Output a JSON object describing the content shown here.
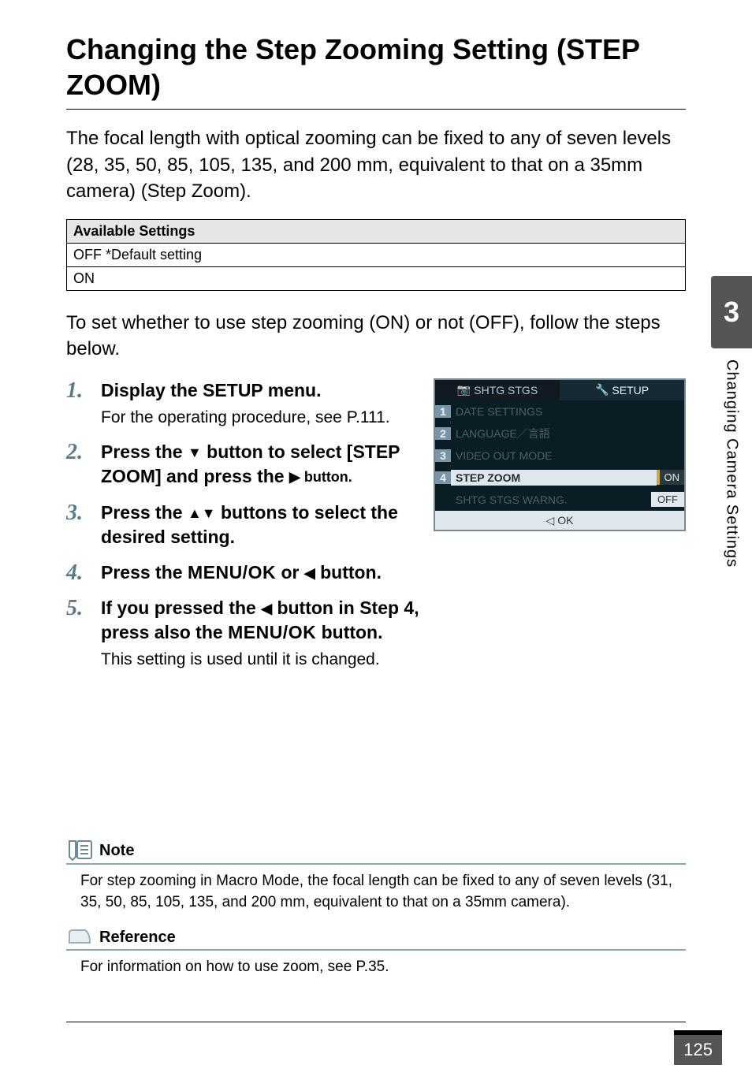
{
  "chapter_tab": {
    "number": "3",
    "label": "Changing Camera Settings"
  },
  "title": "Changing the Step Zooming Setting (STEP ZOOM)",
  "intro": "The focal length with optical zooming can be fixed to any of seven levels (28, 35, 50, 85, 105, 135, and 200 mm, equivalent to that on a 35mm camera) (Step Zoom).",
  "table": {
    "header": "Available Settings",
    "rows": [
      "OFF *Default setting",
      "ON"
    ]
  },
  "para2": "To set whether to use step zooming (ON) or not (OFF), follow the steps below.",
  "steps": [
    {
      "head": "Display the SETUP menu.",
      "sub": "For the operating procedure, see P.111."
    },
    {
      "head_pre": "Press the ",
      "head_mid": "▼",
      "head_post": " button to select [STEP ZOOM] and press the ",
      "head_tail": "▶ button."
    },
    {
      "head_pre": "Press the ",
      "head_mid": "▲▼",
      "head_post": " buttons to select the desired setting."
    },
    {
      "head_pre": "Press the ",
      "head_key": "MENU/OK",
      "head_mid": " or ",
      "head_tri": "◀",
      "head_post": " button."
    },
    {
      "head_pre": "If you pressed the ",
      "head_tri": "◀",
      "head_mid": " button in Step 4, press also the ",
      "head_key": "MENU/OK",
      "head_post": " button.",
      "sub": "This setting is used until it is changed."
    }
  ],
  "lcd": {
    "tab1_icon": "camera-icon",
    "tab1_label": "SHTG STGS",
    "tab2_icon": "wrench-icon",
    "tab2_label": "SETUP",
    "rows": [
      {
        "n": "1",
        "label": "DATE SETTINGS"
      },
      {
        "n": "2",
        "label": "LANGUAGE／言語"
      },
      {
        "n": "3",
        "label": "VIDEO OUT MODE"
      },
      {
        "n": "4",
        "label": "STEP ZOOM",
        "opt": "ON"
      }
    ],
    "row5_label": "SHTG STGS WARNG.",
    "row5_opt": "OFF",
    "foot": "◁ OK"
  },
  "note": {
    "label": "Note",
    "body": "For step zooming in Macro Mode, the focal length can be fixed to any of seven levels (31, 35, 50, 85, 105, 135, and 200 mm, equivalent to that on a 35mm camera)."
  },
  "reference": {
    "label": "Reference",
    "body": "For information on how to use zoom, see P.35."
  },
  "page_number": "125"
}
